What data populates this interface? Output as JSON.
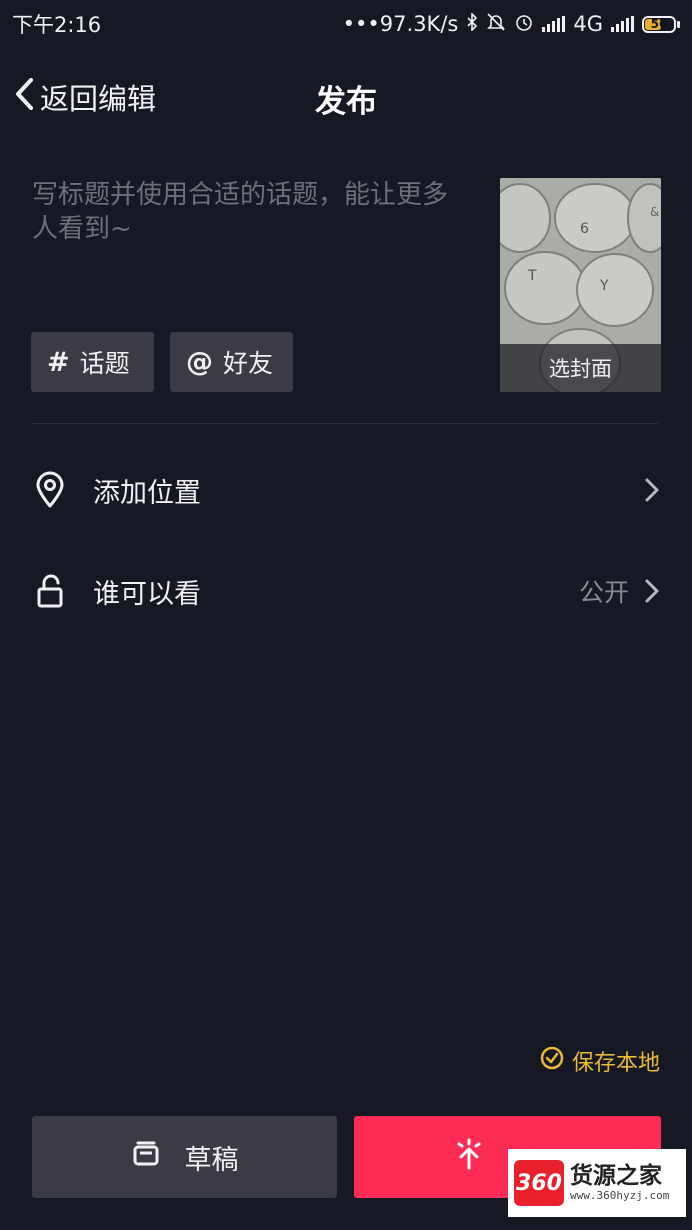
{
  "status_bar": {
    "time": "下午2:16",
    "network_speed": "•••97.3K/s",
    "network_type": "4G",
    "battery_level": "56",
    "battery_fraction": 0.56,
    "icons": [
      "bluetooth-icon",
      "mute-icon",
      "alarm-icon",
      "signal-icon",
      "signal-icon",
      "battery-icon"
    ]
  },
  "header": {
    "back_label": "返回编辑",
    "title": "发布"
  },
  "caption": {
    "placeholder": "写标题并使用合适的话题，能让更多人看到~"
  },
  "cover": {
    "label": "选封面"
  },
  "tags": {
    "topic_icon": "#",
    "topic_label": "话题",
    "friend_icon": "@",
    "friend_label": "好友"
  },
  "settings": {
    "location_label": "添加位置",
    "privacy_label": "谁可以看",
    "privacy_value": "公开"
  },
  "footer": {
    "save_local_label": "保存本地",
    "draft_label": "草稿",
    "publish_label": ""
  },
  "watermark": {
    "logo_text": "360",
    "title": "货源之家",
    "url": "www.360hyzj.com"
  },
  "colors": {
    "background": "#161823",
    "accent": "#fe2c55",
    "save_local": "#e8b93a",
    "button_bg": "#3a3b44"
  }
}
